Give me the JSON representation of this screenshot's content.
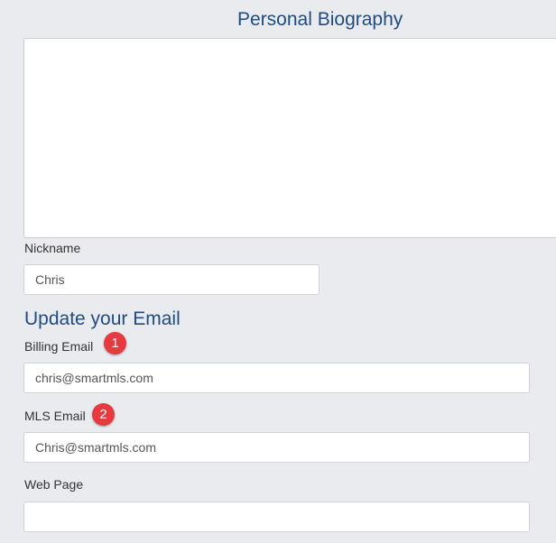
{
  "biography": {
    "title": "Personal Biography",
    "value": ""
  },
  "nickname": {
    "label": "Nickname",
    "value": "Chris"
  },
  "email_section": {
    "title": "Update your Email",
    "billing": {
      "label": "Billing Email",
      "value": "chris@smartmls.com",
      "badge": "1"
    },
    "mls": {
      "label": "MLS Email",
      "value": "Chris@smartmls.com",
      "badge": "2"
    },
    "web_page": {
      "label": "Web Page",
      "value": ""
    }
  },
  "colors": {
    "background": "#e9ebee",
    "heading": "#1f4c82",
    "badge": "#e53a3f"
  }
}
